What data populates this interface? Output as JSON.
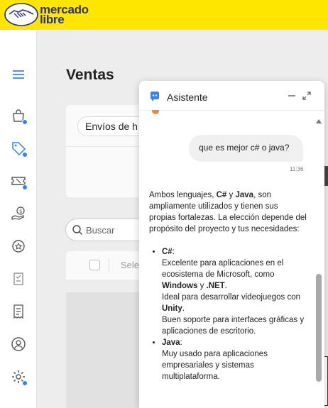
{
  "brand": {
    "line1": "mercado",
    "line2": "libre",
    "color": "#ffe600",
    "text_color": "#2d3277"
  },
  "nav": {
    "items": [
      "menu-icon",
      "bag-icon",
      "tag-icon",
      "ticket-icon",
      "money-hand-icon",
      "medal-icon",
      "checklist-icon",
      "receipt-icon",
      "profile-icon",
      "gear-icon"
    ],
    "notification_color": "#3483fa"
  },
  "page": {
    "title": "Ventas"
  },
  "tabs": {
    "first": "Envíos de h"
  },
  "search": {
    "placeholder": "Buscar"
  },
  "list": {
    "select_label": "Selec"
  },
  "assistant": {
    "title": "Asistente",
    "user_message": "que es mejor c# o java?",
    "timestamp": "11:36",
    "reply": {
      "intro_before_csharp": "Ambos lenguajes, ",
      "csharp": "C#",
      "intro_y": " y ",
      "java": "Java",
      "intro_rest": ", son ampliamente utilizados y tienen sus propias fortalezas. La elección depende del propósito del proyecto y tus necesidades:",
      "csharp_heading": "C#",
      "csharp_p1_a": "Excelente para aplicaciones en el ecosistema de Microsoft, como ",
      "windows": "Windows",
      "csharp_p1_y": " y ",
      "net": ".NET",
      "csharp_p1_end": ".",
      "csharp_p2_a": "Ideal para desarrollar videojuegos con ",
      "unity": "Unity",
      "csharp_p2_end": ".",
      "csharp_p3": "Buen soporte para interfaces gráficas y aplicaciones de escritorio.",
      "java_heading": "Java",
      "java_p1": "Muy usado para aplicaciones empresariales y sistemas multiplataforma."
    }
  }
}
